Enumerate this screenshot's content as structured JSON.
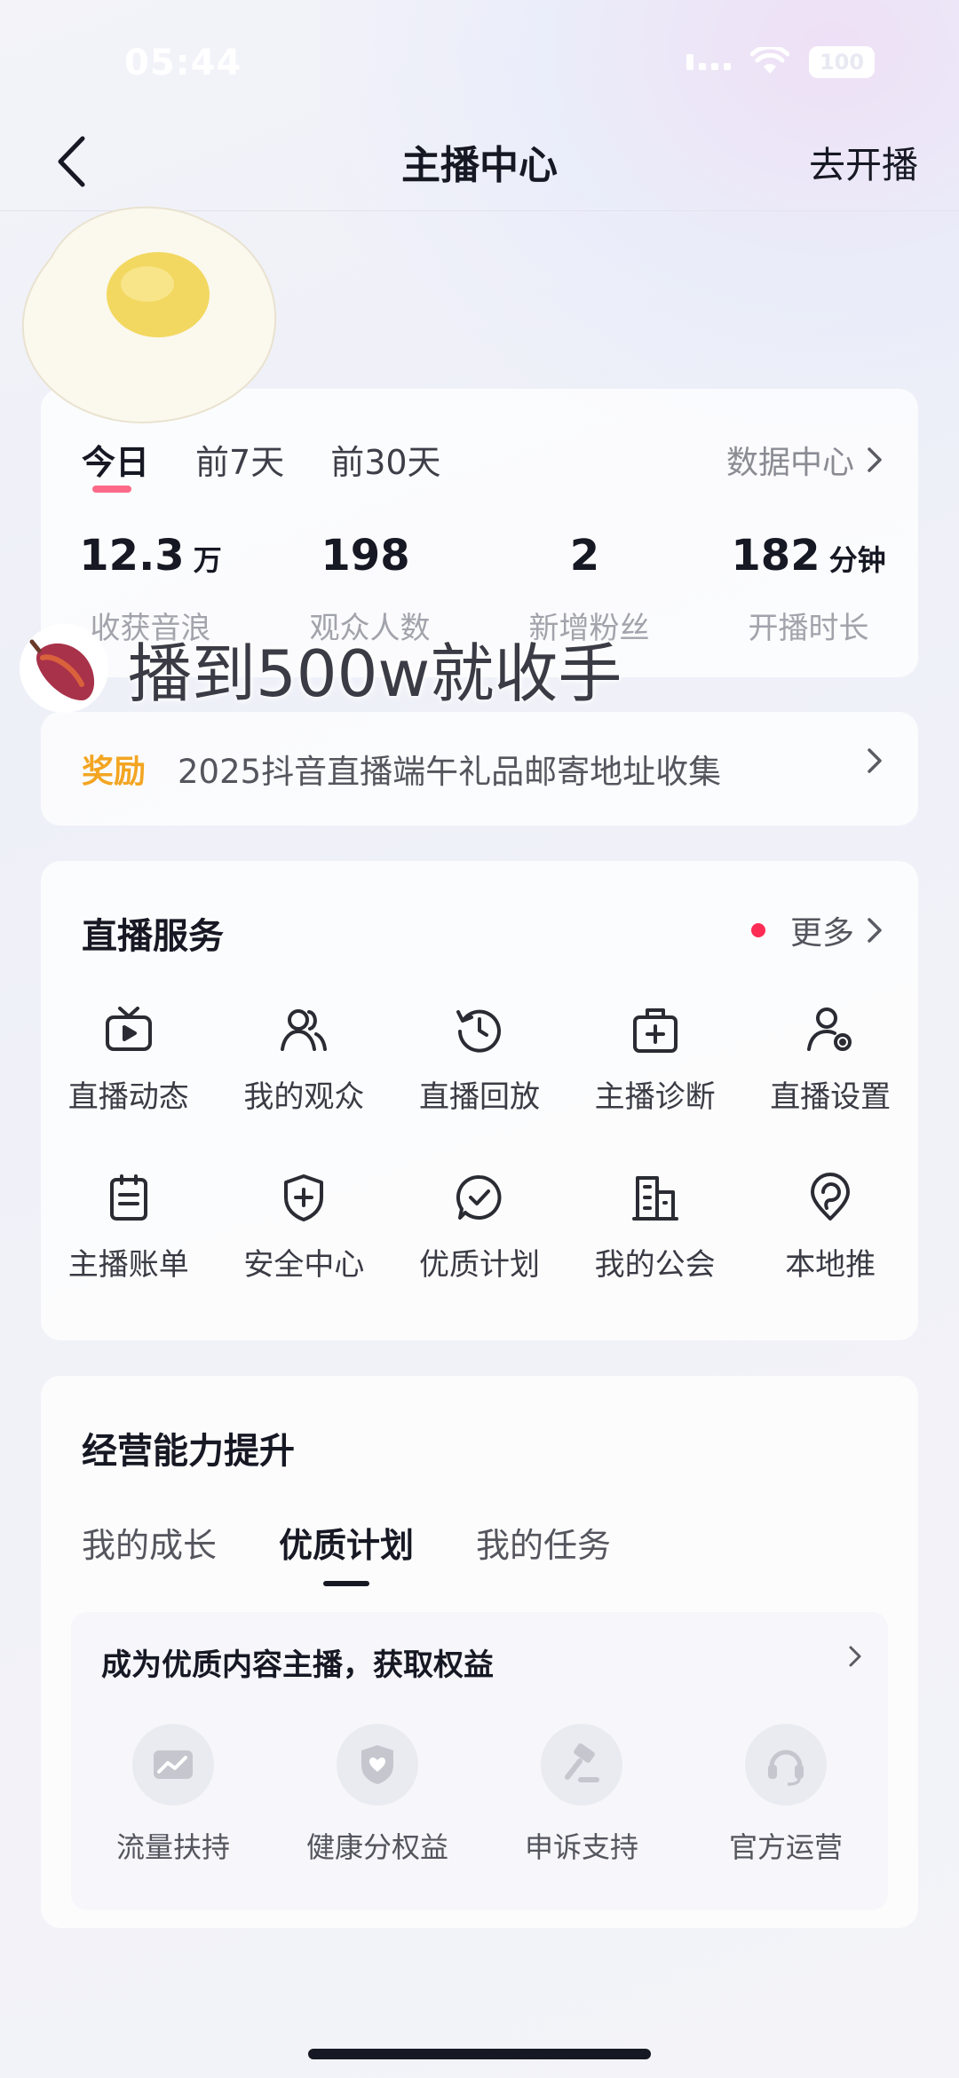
{
  "status_bar": {
    "time": "05:44",
    "battery": "100"
  },
  "nav": {
    "title": "主播中心",
    "action": "去开播"
  },
  "stats_card": {
    "tabs": [
      "今日",
      "前7天",
      "前30天"
    ],
    "data_center": "数据中心",
    "stats": [
      {
        "value": "12.3",
        "unit": "万",
        "label": "收获音浪"
      },
      {
        "value": "198",
        "unit": "",
        "label": "观众人数"
      },
      {
        "value": "2",
        "unit": "",
        "label": "新增粉丝"
      },
      {
        "value": "182",
        "unit": "分钟",
        "label": "开播时长"
      }
    ]
  },
  "overlay": {
    "caption": "播到500w就收手"
  },
  "reward": {
    "tag": "奖励",
    "text": "2025抖音直播端午礼品邮寄地址收集"
  },
  "services": {
    "title": "直播服务",
    "more": "更多",
    "items": [
      {
        "label": "直播动态",
        "icon": "tv-icon"
      },
      {
        "label": "我的观众",
        "icon": "audience-icon"
      },
      {
        "label": "直播回放",
        "icon": "replay-icon"
      },
      {
        "label": "主播诊断",
        "icon": "diagnosis-icon"
      },
      {
        "label": "直播设置",
        "icon": "user-settings-icon"
      },
      {
        "label": "主播账单",
        "icon": "bill-icon"
      },
      {
        "label": "安全中心",
        "icon": "shield-plus-icon"
      },
      {
        "label": "优质计划",
        "icon": "check-circle-icon"
      },
      {
        "label": "我的公会",
        "icon": "building-icon"
      },
      {
        "label": "本地推",
        "icon": "location-icon"
      }
    ]
  },
  "growth": {
    "title": "经营能力提升",
    "tabs": [
      "我的成长",
      "优质计划",
      "我的任务"
    ],
    "plan_title": "成为优质内容主播，获取权益",
    "benefits": [
      {
        "label": "流量扶持",
        "icon": "traffic-icon"
      },
      {
        "label": "健康分权益",
        "icon": "health-shield-icon"
      },
      {
        "label": "申诉支持",
        "icon": "gavel-icon"
      },
      {
        "label": "官方运营",
        "icon": "headset-icon"
      }
    ]
  }
}
